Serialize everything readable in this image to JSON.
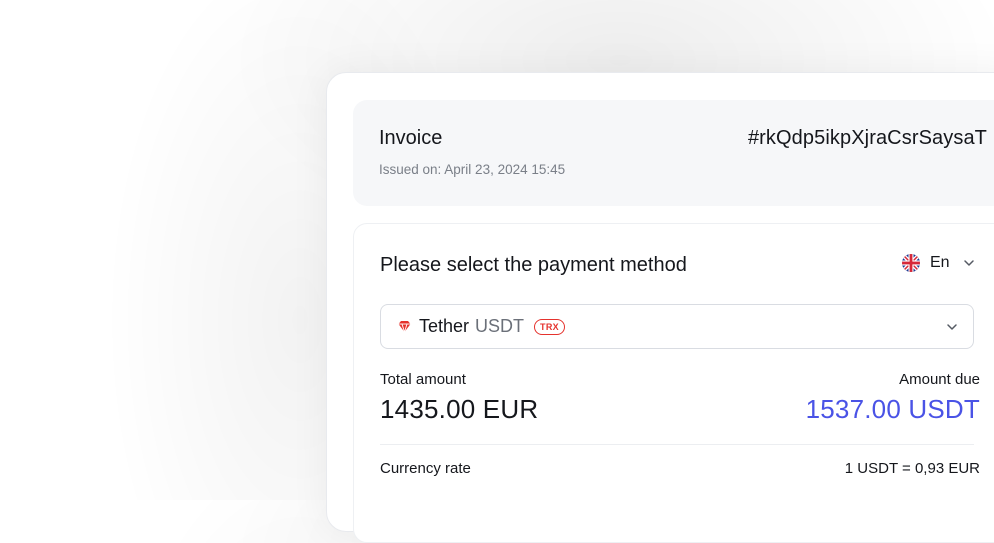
{
  "invoice": {
    "title": "Invoice",
    "id": "#rkQdp5ikpXjraCsrSaysaT",
    "issued": "Issued on: April 23, 2024 15:45"
  },
  "payment": {
    "title": "Please select the payment method",
    "language": {
      "label": "En",
      "flag_icon": "uk-flag-icon"
    },
    "method": {
      "name": "Tether",
      "code": "USDT",
      "network": "TRX",
      "icon": "tether-gem-icon"
    },
    "total_label": "Total amount",
    "total_value": "1435.00 EUR",
    "due_label": "Amount due",
    "due_value": "1537.00 USDT",
    "rate_label": "Currency rate",
    "rate_value": "1 USDT = 0,93 EUR"
  },
  "colors": {
    "accent": "#4a53e6",
    "network_badge": "#e5322d",
    "panel_bg": "#f6f7f9"
  }
}
